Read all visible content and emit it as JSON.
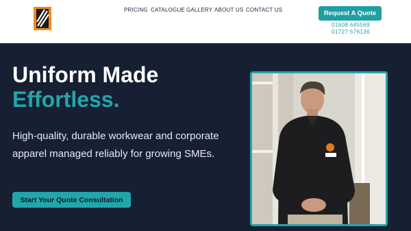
{
  "header": {
    "nav": [
      {
        "label": "PRICING"
      },
      {
        "label": "CATALOGUE"
      },
      {
        "label": "GALLERY"
      },
      {
        "label": "ABOUT US"
      },
      {
        "label": "CONTACT US"
      }
    ],
    "quote_button": "Request A Quote",
    "phone_1": "01608 645569",
    "phone_2": "01727 576136"
  },
  "hero": {
    "title_line1": "Uniform Made",
    "title_line2": "Effortless.",
    "subtitle": "High-quality, durable workwear and corporate apparel managed reliably for growing SMEs.",
    "cta_label": "Start Your Quote Consultation",
    "image_icon": "model-wearing-branded-sweater-photo"
  },
  "colors": {
    "accent": "#22a6ab",
    "hero_bg": "#172033",
    "nav_text": "#1c2541",
    "logo_orange": "#f08a1c"
  }
}
